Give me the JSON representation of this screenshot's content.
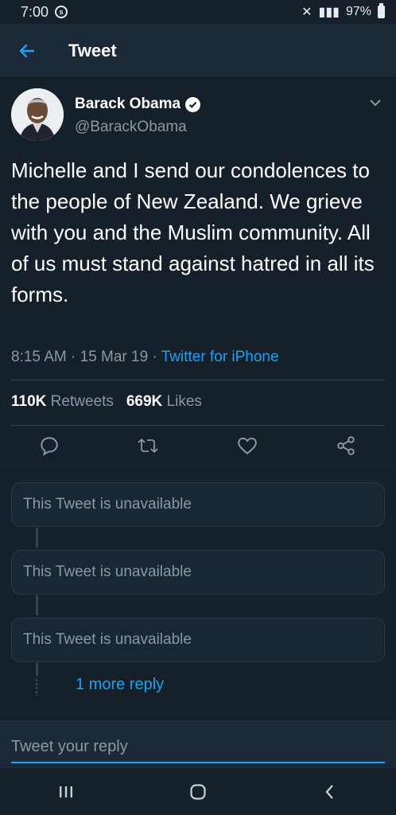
{
  "status_bar": {
    "time": "7:00",
    "battery": "97%"
  },
  "header": {
    "title": "Tweet"
  },
  "tweet": {
    "author_name": "Barack Obama",
    "author_handle": "@BarackObama",
    "text": "Michelle and I send our condolences to the people of New Zealand. We grieve with you and the Muslim community. All of us must stand against hatred in all its forms.",
    "time": "8:15 AM",
    "date": "15 Mar 19",
    "source": "Twitter for iPhone",
    "retweets_count": "110K",
    "retweets_label": "Retweets",
    "likes_count": "669K",
    "likes_label": "Likes"
  },
  "replies": [
    {
      "text": "This Tweet is unavailable"
    },
    {
      "text": "This Tweet is unavailable"
    },
    {
      "text": "This Tweet is unavailable"
    }
  ],
  "more_replies": "1 more reply",
  "reply_input": {
    "placeholder": "Tweet your reply"
  },
  "colors": {
    "background": "#15202b",
    "accent": "#1da1f2",
    "secondary_text": "#8899a6"
  },
  "icons": {
    "back": "arrow-left-icon",
    "verified": "verified-badge-icon",
    "caret": "chevron-down-icon",
    "reply": "reply-icon",
    "retweet": "retweet-icon",
    "like": "heart-icon",
    "share": "share-icon"
  }
}
